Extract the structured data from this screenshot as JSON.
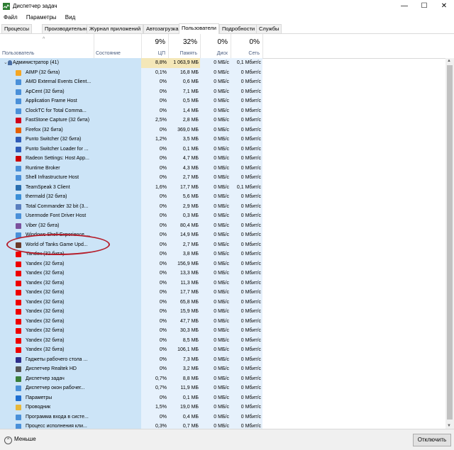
{
  "window": {
    "title": "Диспетчер задач",
    "min": "—",
    "max": "☐",
    "close": "✕"
  },
  "menu": [
    "Файл",
    "Параметры",
    "Вид"
  ],
  "tabs": [
    "Процессы",
    "Производительность",
    "Журнал приложений",
    "Автозагрузка",
    "Пользователи",
    "Подробности",
    "Службы"
  ],
  "active_tab": "Пользователи",
  "header": {
    "user": "Пользователь",
    "status": "Состояние",
    "cpu_pct": "9%",
    "cpu": "ЦП",
    "mem_pct": "32%",
    "mem": "Память",
    "disk_pct": "0%",
    "disk": "Диск",
    "net_pct": "0%",
    "net": "Сеть"
  },
  "group": {
    "name": "Администратор (41)",
    "cpu": "8,8%",
    "mem": "1 063,9 МБ",
    "disk": "0 МБ/с",
    "net": "0,1 Мбит/с"
  },
  "rows": [
    {
      "name": "AIMP (32 бита)",
      "cpu": "0,1%",
      "mem": "16,8 МБ",
      "disk": "0 МБ/с",
      "net": "0 Мбит/с",
      "icon": "aimp-icon",
      "color": "#f5a623"
    },
    {
      "name": "AMD External Events Client...",
      "cpu": "0%",
      "mem": "0,6 МБ",
      "disk": "0 МБ/с",
      "net": "0 Мбит/с",
      "icon": "app-icon",
      "color": "#4a90d9"
    },
    {
      "name": "ApCent (32 бита)",
      "cpu": "0%",
      "mem": "7,1 МБ",
      "disk": "0 МБ/с",
      "net": "0 Мбит/с",
      "icon": "app-icon",
      "color": "#4a90d9"
    },
    {
      "name": "Application Frame Host",
      "cpu": "0%",
      "mem": "0,5 МБ",
      "disk": "0 МБ/с",
      "net": "0 Мбит/с",
      "icon": "app-icon",
      "color": "#4a90d9"
    },
    {
      "name": "ClockTC for Total Comma...",
      "cpu": "0%",
      "mem": "1,4 МБ",
      "disk": "0 МБ/с",
      "net": "0 Мбит/с",
      "icon": "app-icon",
      "color": "#4a90d9"
    },
    {
      "name": "FastStone Capture (32 бита)",
      "cpu": "2,5%",
      "mem": "2,8 МБ",
      "disk": "0 МБ/с",
      "net": "0 Мбит/с",
      "icon": "faststone-icon",
      "color": "#d0021b"
    },
    {
      "name": "Firefox (32 бита)",
      "cpu": "0%",
      "mem": "369,0 МБ",
      "disk": "0 МБ/с",
      "net": "0 Мбит/с",
      "icon": "firefox-icon",
      "color": "#e66000"
    },
    {
      "name": "Punto Switcher (32 бита)",
      "cpu": "1,2%",
      "mem": "3,5 МБ",
      "disk": "0 МБ/с",
      "net": "0 Мбит/с",
      "icon": "punto-icon",
      "color": "#2f5bb7"
    },
    {
      "name": "Punto Switcher Loader for ...",
      "cpu": "0%",
      "mem": "0,1 МБ",
      "disk": "0 МБ/с",
      "net": "0 Мбит/с",
      "icon": "punto-icon",
      "color": "#2f5bb7"
    },
    {
      "name": "Radeon Settings: Host App...",
      "cpu": "0%",
      "mem": "4,7 МБ",
      "disk": "0 МБ/с",
      "net": "0 Мбит/с",
      "icon": "radeon-icon",
      "color": "#c00"
    },
    {
      "name": "Runtime Broker",
      "cpu": "0%",
      "mem": "4,3 МБ",
      "disk": "0 МБ/с",
      "net": "0 Мбит/с",
      "icon": "app-icon",
      "color": "#4a90d9"
    },
    {
      "name": "Shell Infrastructure Host",
      "cpu": "0%",
      "mem": "2,7 МБ",
      "disk": "0 МБ/с",
      "net": "0 Мбит/с",
      "icon": "app-icon",
      "color": "#4a90d9"
    },
    {
      "name": "TeamSpeak 3 Client",
      "cpu": "1,6%",
      "mem": "17,7 МБ",
      "disk": "0 МБ/с",
      "net": "0,1 Мбит/с",
      "icon": "teamspeak-icon",
      "color": "#2a6fb0"
    },
    {
      "name": "thermald (32 бита)",
      "cpu": "0%",
      "mem": "5,6 МБ",
      "disk": "0 МБ/с",
      "net": "0 Мбит/с",
      "icon": "thermald-icon",
      "color": "#3b8fd8"
    },
    {
      "name": "Total Commander 32 bit (3...",
      "cpu": "0%",
      "mem": "2,9 МБ",
      "disk": "0 МБ/с",
      "net": "0 Мбит/с",
      "icon": "totalcmd-icon",
      "color": "#5a7fbf"
    },
    {
      "name": "Usermode Font Driver Host",
      "cpu": "0%",
      "mem": "0,3 МБ",
      "disk": "0 МБ/с",
      "net": "0 Мбит/с",
      "icon": "app-icon",
      "color": "#4a90d9"
    },
    {
      "name": "Viber (32 бита)",
      "cpu": "0%",
      "mem": "80,4 МБ",
      "disk": "0 МБ/с",
      "net": "0 Мбит/с",
      "icon": "viber-icon",
      "color": "#7b519d"
    },
    {
      "name": "Windows Shell Experience ...",
      "cpu": "0%",
      "mem": "14,9 МБ",
      "disk": "0 МБ/с",
      "net": "0 Мбит/с",
      "icon": "app-icon",
      "color": "#4a90d9"
    },
    {
      "name": "World of Tanks Game Upd...",
      "cpu": "0%",
      "mem": "2,7 МБ",
      "disk": "0 МБ/с",
      "net": "0 Мбит/с",
      "icon": "wot-icon",
      "color": "#6b3a2a"
    },
    {
      "name": "Yandex (32 бита)",
      "cpu": "0%",
      "mem": "3,8 МБ",
      "disk": "0 МБ/с",
      "net": "0 Мбит/с",
      "icon": "yandex-icon",
      "color": "#e00"
    },
    {
      "name": "Yandex (32 бита)",
      "cpu": "0%",
      "mem": "156,9 МБ",
      "disk": "0 МБ/с",
      "net": "0 Мбит/с",
      "icon": "yandex-icon",
      "color": "#e00"
    },
    {
      "name": "Yandex (32 бита)",
      "cpu": "0%",
      "mem": "13,3 МБ",
      "disk": "0 МБ/с",
      "net": "0 Мбит/с",
      "icon": "yandex-icon",
      "color": "#e00"
    },
    {
      "name": "Yandex (32 бита)",
      "cpu": "0%",
      "mem": "11,3 МБ",
      "disk": "0 МБ/с",
      "net": "0 Мбит/с",
      "icon": "yandex-icon",
      "color": "#e00"
    },
    {
      "name": "Yandex (32 бита)",
      "cpu": "0%",
      "mem": "17,7 МБ",
      "disk": "0 МБ/с",
      "net": "0 Мбит/с",
      "icon": "yandex-icon",
      "color": "#e00"
    },
    {
      "name": "Yandex (32 бита)",
      "cpu": "0%",
      "mem": "65,8 МБ",
      "disk": "0 МБ/с",
      "net": "0 Мбит/с",
      "icon": "yandex-icon",
      "color": "#e00"
    },
    {
      "name": "Yandex (32 бита)",
      "cpu": "0%",
      "mem": "15,9 МБ",
      "disk": "0 МБ/с",
      "net": "0 Мбит/с",
      "icon": "yandex-icon",
      "color": "#e00"
    },
    {
      "name": "Yandex (32 бита)",
      "cpu": "0%",
      "mem": "47,7 МБ",
      "disk": "0 МБ/с",
      "net": "0 Мбит/с",
      "icon": "yandex-icon",
      "color": "#e00"
    },
    {
      "name": "Yandex (32 бита)",
      "cpu": "0%",
      "mem": "30,3 МБ",
      "disk": "0 МБ/с",
      "net": "0 Мбит/с",
      "icon": "yandex-icon",
      "color": "#e00"
    },
    {
      "name": "Yandex (32 бита)",
      "cpu": "0%",
      "mem": "8,5 МБ",
      "disk": "0 МБ/с",
      "net": "0 Мбит/с",
      "icon": "yandex-icon",
      "color": "#e00"
    },
    {
      "name": "Yandex (32 бита)",
      "cpu": "0%",
      "mem": "106,1 МБ",
      "disk": "0 МБ/с",
      "net": "0 Мбит/с",
      "icon": "yandex-icon",
      "color": "#e00"
    },
    {
      "name": "Гаджеты рабочего стола ...",
      "cpu": "0%",
      "mem": "7,3 МБ",
      "disk": "0 МБ/с",
      "net": "0 Мбит/с",
      "icon": "gadgets-icon",
      "color": "#2e2e8a"
    },
    {
      "name": "Диспетчер Realtek HD",
      "cpu": "0%",
      "mem": "3,2 МБ",
      "disk": "0 МБ/с",
      "net": "0 Мбит/с",
      "icon": "realtek-icon",
      "color": "#555"
    },
    {
      "name": "Диспетчер задач",
      "cpu": "0,7%",
      "mem": "8,8 МБ",
      "disk": "0 МБ/с",
      "net": "0 Мбит/с",
      "icon": "taskmgr-icon",
      "color": "#3a7f3a"
    },
    {
      "name": "Диспетчер окон рабочег...",
      "cpu": "0,7%",
      "mem": "11,9 МБ",
      "disk": "0 МБ/с",
      "net": "0 Мбит/с",
      "icon": "app-icon",
      "color": "#4a90d9"
    },
    {
      "name": "Параметры",
      "cpu": "0%",
      "mem": "0,1 МБ",
      "disk": "0 МБ/с",
      "net": "0 Мбит/с",
      "icon": "settings-icon",
      "color": "#1f6fd1"
    },
    {
      "name": "Проводник",
      "cpu": "1,5%",
      "mem": "19,0 МБ",
      "disk": "0 МБ/с",
      "net": "0 Мбит/с",
      "icon": "explorer-icon",
      "color": "#e8b73a"
    },
    {
      "name": "Программа входа в систе...",
      "cpu": "0%",
      "mem": "0,4 МБ",
      "disk": "0 МБ/с",
      "net": "0 Мбит/с",
      "icon": "app-icon",
      "color": "#4a90d9"
    },
    {
      "name": "Процесс исполнения кли...",
      "cpu": "0,3%",
      "mem": "0,7 МБ",
      "disk": "0 МБ/с",
      "net": "0 Мбит/с",
      "icon": "app-icon",
      "color": "#4a90d9"
    }
  ],
  "footer": {
    "less": "Меньше",
    "disconnect": "Отключить"
  },
  "annotation_color": "#b51d2a"
}
